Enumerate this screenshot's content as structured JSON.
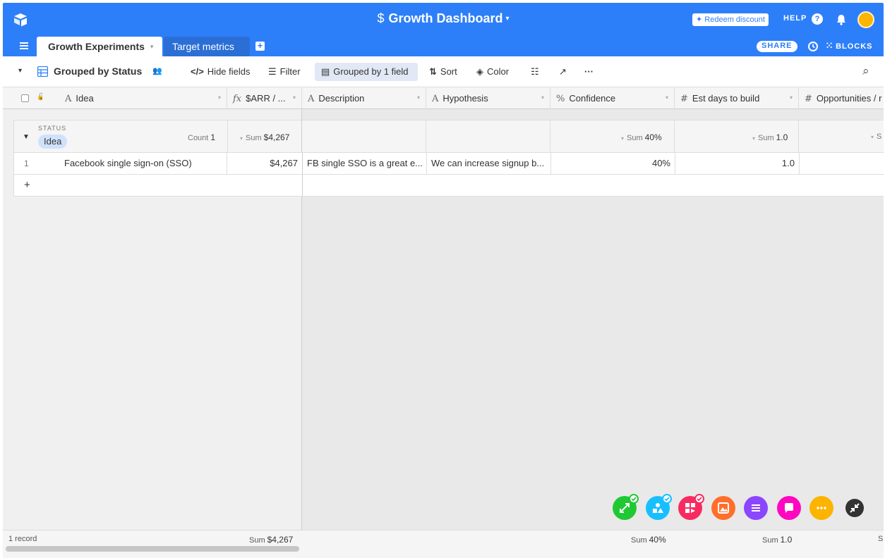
{
  "header": {
    "app_title": "Growth Dashboard",
    "app_title_caret": "▾",
    "dollar_glyph": "$",
    "redeem_label": "Redeem discount",
    "redeem_glyph": "✦",
    "help_label": "HELP",
    "help_glyph": "?"
  },
  "tabs": {
    "active": "Growth Experiments",
    "active_caret": "▾",
    "inactive": "Target metrics",
    "add_glyph": "+",
    "share_label": "SHARE",
    "blocks_label": "BLOCKS",
    "blocks_glyph": "⁙"
  },
  "toolbar": {
    "collapse_glyph": "▾",
    "view_name": "Grouped by Status",
    "view_people_glyph": "👥",
    "hide_fields": "Hide fields",
    "hide_fields_glyph": "</>",
    "filter": "Filter",
    "filter_glyph": "☰",
    "grouped": "Grouped by 1 field",
    "grouped_glyph": "▤",
    "sort": "Sort",
    "sort_glyph": "⇅",
    "color": "Color",
    "color_glyph": "◈",
    "row_height_glyph": "☷",
    "share_view_glyph": "↗",
    "more_glyph": "···",
    "search_glyph": "⌕"
  },
  "columns": [
    {
      "type_glyph": "A",
      "label": "Idea"
    },
    {
      "type_glyph": "fx",
      "label": "$ARR / ..."
    },
    {
      "type_glyph": "A",
      "label": "Description"
    },
    {
      "type_glyph": "A",
      "label": "Hypothesis"
    },
    {
      "type_glyph": "%",
      "label": "Confidence"
    },
    {
      "type_glyph": "#",
      "label": "Est days to build"
    },
    {
      "type_glyph": "#",
      "label": "Opportunities / r"
    }
  ],
  "column_dropdown_glyph": "▾",
  "group": {
    "field_label": "STATUS",
    "value": "Idea",
    "toggle_glyph": "▼",
    "count_label": "Count",
    "count": "1",
    "sum_label": "Sum",
    "sum_arr": "$4,267",
    "sum_confidence": "40%",
    "sum_days": "1.0",
    "sum_opportunities_partial": "S"
  },
  "rows": [
    {
      "num": "1",
      "idea": "Facebook single sign-on (SSO)",
      "arr": "$4,267",
      "description": "FB single SSO is a great e...",
      "hypothesis": "We can increase signup b...",
      "confidence": "40%",
      "est_days": "1.0"
    }
  ],
  "add_row_glyph": "+",
  "footer": {
    "records": "1 record",
    "sum_label": "Sum",
    "sum_arr": "$4,267",
    "sum_confidence": "40%",
    "sum_days": "1.0",
    "sum_opportunities_partial": "S"
  },
  "blocks_launcher": [
    {
      "name": "expand-block",
      "color": "#20c933",
      "badge": true
    },
    {
      "name": "chart-block",
      "color": "#18bfff",
      "badge": true
    },
    {
      "name": "apps-block",
      "color": "#f82b60",
      "badge": true
    },
    {
      "name": "page-designer-block",
      "color": "#ff6f2c",
      "badge": false
    },
    {
      "name": "summary-block",
      "color": "#8b46ff",
      "badge": false
    },
    {
      "name": "chat-block",
      "color": "#ff08c2",
      "badge": false
    },
    {
      "name": "more-blocks",
      "color": "#fcb400",
      "badge": false
    },
    {
      "name": "collapse-blocks",
      "color": "#333333",
      "badge": false
    }
  ]
}
